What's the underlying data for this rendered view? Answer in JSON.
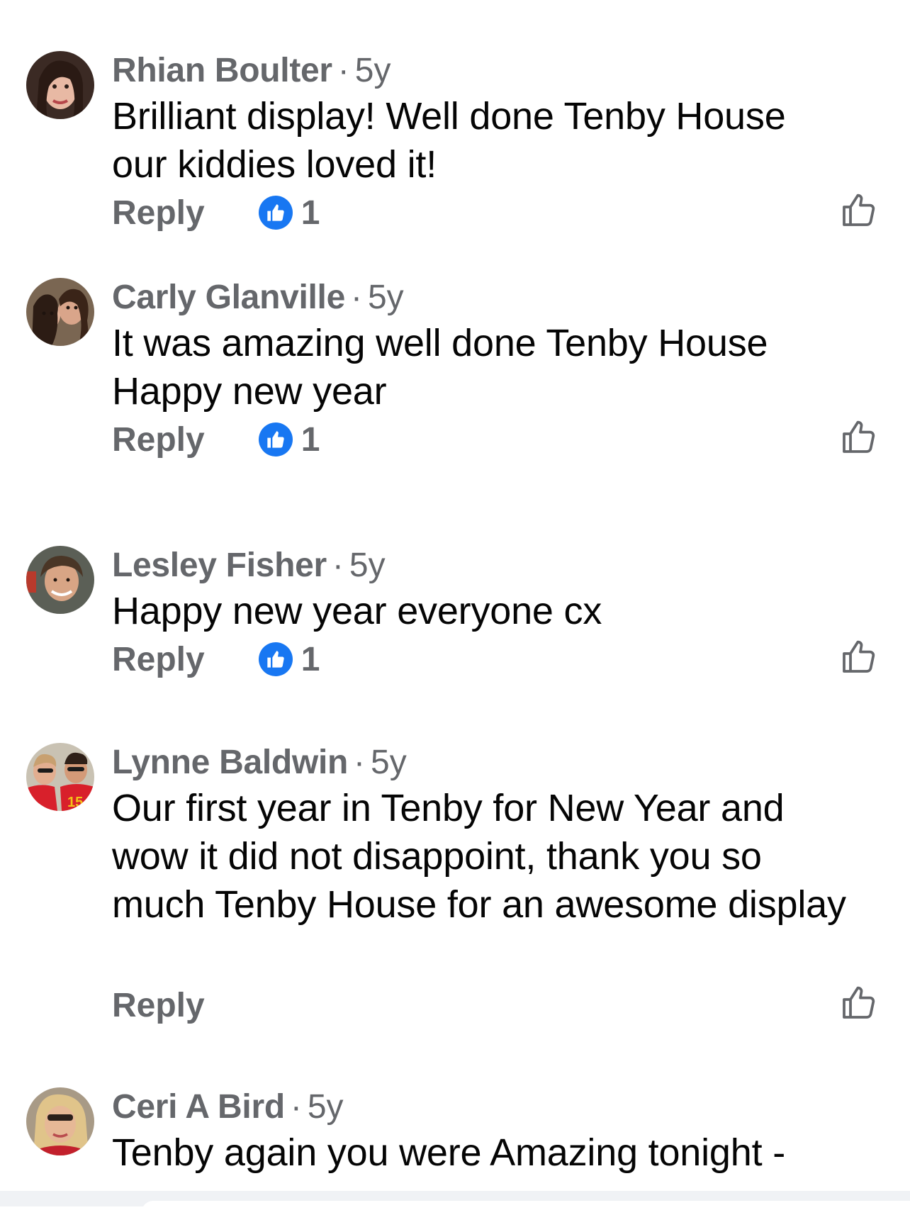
{
  "comments": [
    {
      "author": "Rhian Boulter",
      "time": "5y",
      "text": "Brilliant display! Well done Tenby House our kiddies loved it!",
      "reply_label": "Reply",
      "reaction_count": "1"
    },
    {
      "author": "Carly Glanville",
      "time": "5y",
      "text": "It was amazing well done Tenby House Happy new year",
      "reply_label": "Reply",
      "reaction_count": "1"
    },
    {
      "author": "Lesley Fisher",
      "time": "5y",
      "text": "Happy new year everyone cx",
      "reply_label": "Reply",
      "reaction_count": "1"
    },
    {
      "author": "Lynne Baldwin",
      "time": "5y",
      "text": "Our first year in Tenby for New Year and wow it did not disappoint, thank you so much Tenby House for an awesome display",
      "reply_label": "Reply"
    },
    {
      "author": "Ceri A Bird",
      "time": "5y",
      "text": "Tenby again you were Amazing tonight -"
    }
  ],
  "separator": "·",
  "colors": {
    "secondary_text": "#65676b",
    "primary_text": "#050505",
    "like_blue": "#1877f2"
  },
  "icons": {
    "reaction": "like-reaction-icon",
    "like_button": "thumbs-up-outline-icon"
  }
}
